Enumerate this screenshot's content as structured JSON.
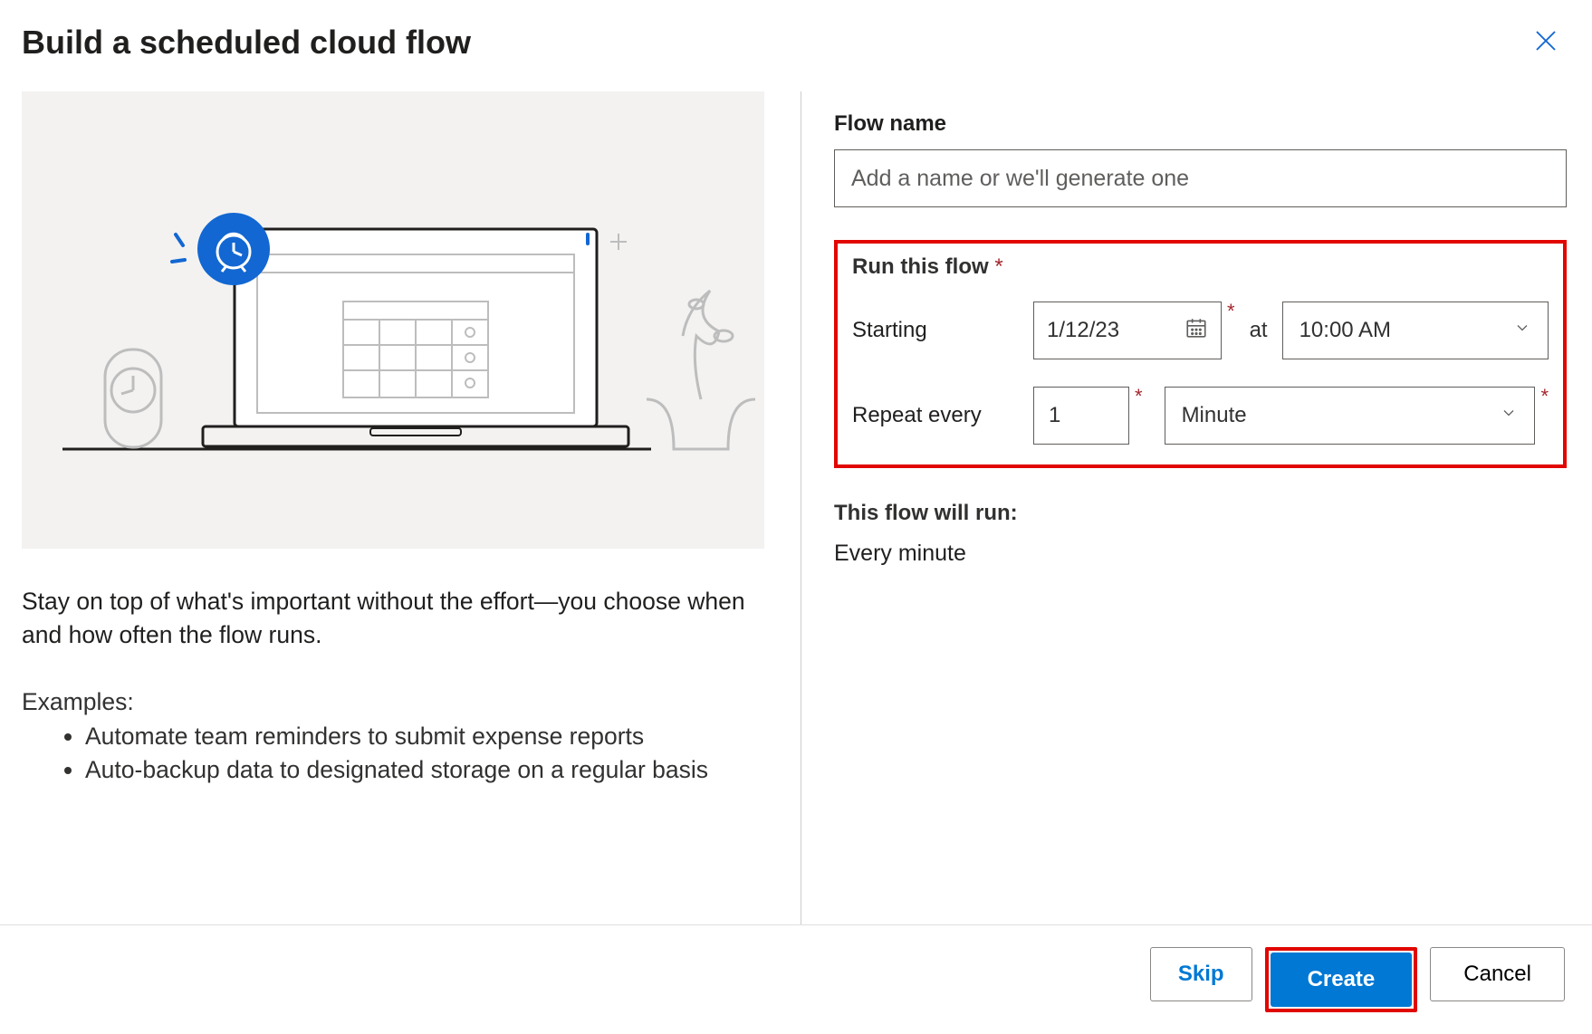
{
  "dialog": {
    "title": "Build a scheduled cloud flow"
  },
  "left": {
    "intro": "Stay on top of what's important without the effort—you choose when and how often the flow runs.",
    "examplesLabel": "Examples:",
    "examples": [
      "Automate team reminders to submit expense reports",
      "Auto-backup data to designated storage on a regular basis"
    ]
  },
  "form": {
    "flowNameLabel": "Flow name",
    "flowNamePlaceholder": "Add a name or we'll generate one",
    "flowNameValue": "",
    "runLabel": "Run this flow",
    "startingLabel": "Starting",
    "dateValue": "1/12/23",
    "atLabel": "at",
    "timeValue": "10:00 AM",
    "repeatLabel": "Repeat every",
    "repeatCount": "1",
    "repeatUnit": "Minute",
    "summaryLabel": "This flow will run:",
    "summaryText": "Every minute"
  },
  "footer": {
    "skip": "Skip",
    "create": "Create",
    "cancel": "Cancel"
  }
}
